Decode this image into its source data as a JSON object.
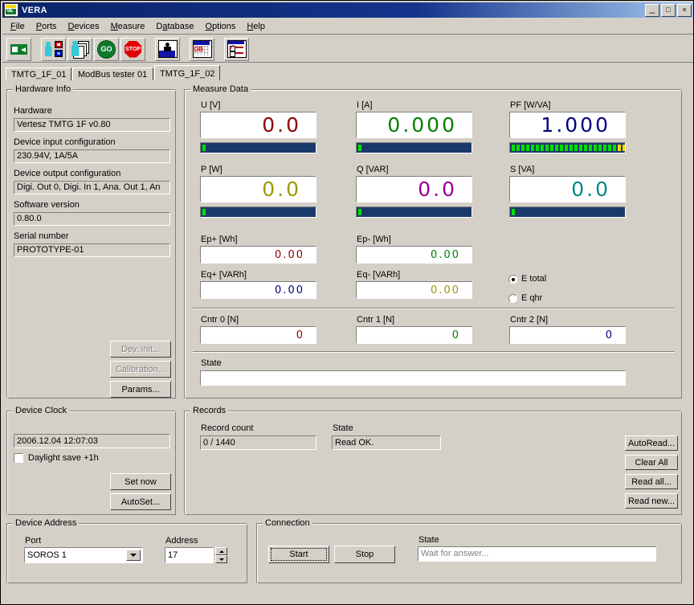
{
  "window": {
    "title": "VERA",
    "icon": "app-icon",
    "buttons": {
      "minimize": "_",
      "maximize": "□",
      "close": "×"
    }
  },
  "menu": [
    {
      "label": "File",
      "accel": "F"
    },
    {
      "label": "Ports",
      "accel": "P"
    },
    {
      "label": "Devices",
      "accel": "D"
    },
    {
      "label": "Measure",
      "accel": "M"
    },
    {
      "label": "Database",
      "accel": "a"
    },
    {
      "label": "Options",
      "accel": "O"
    },
    {
      "label": "Help",
      "accel": "H"
    }
  ],
  "toolbar": [
    {
      "icon": "connect-arrow-icon"
    },
    {
      "icon": "device-config-icon"
    },
    {
      "icon": "device-list-config-icon"
    },
    {
      "icon": "go-icon",
      "label": "GO"
    },
    {
      "icon": "stop-icon",
      "label": "STOP"
    },
    {
      "icon": "user-icon"
    },
    {
      "icon": "database-icon",
      "label": "DB"
    },
    {
      "icon": "checklist-icon"
    }
  ],
  "tabs": [
    {
      "label": "TMTG_1F_01",
      "active": false
    },
    {
      "label": "ModBus tester 01",
      "active": false
    },
    {
      "label": "TMTG_1F_02",
      "active": true
    }
  ],
  "hardware_info": {
    "title": "Hardware Info",
    "fields": [
      {
        "label": "Hardware",
        "value": "Vertesz TMTG 1F v0.80"
      },
      {
        "label": "Device input configuration",
        "value": "230.94V,  1A/5A"
      },
      {
        "label": "Device output configuration",
        "value": "Digi. Out 0,  Digi. In 1,  Ana. Out 1,  An"
      },
      {
        "label": "Software version",
        "value": "0.80.0"
      },
      {
        "label": "Serial number",
        "value": "PROTOTYPE-01"
      }
    ],
    "buttons": [
      {
        "label": "Dev. init...",
        "enabled": false
      },
      {
        "label": "Calibration...",
        "enabled": false
      },
      {
        "label": "Params...",
        "enabled": true
      }
    ]
  },
  "measure_data": {
    "title": "Measure Data",
    "gauges": [
      {
        "label": "U [V]",
        "value": "0.0",
        "color": "#8b0000",
        "segments": 1,
        "yellow": 0
      },
      {
        "label": "I [A]",
        "value": "0.000",
        "color": "#008000",
        "segments": 1,
        "yellow": 0
      },
      {
        "label": "PF [W/VA]",
        "value": "1.000",
        "color": "#000080",
        "segments": 25,
        "yellow": 3
      },
      {
        "label": "P [W]",
        "value": "0.0",
        "color": "#9b9b00",
        "segments": 1,
        "yellow": 0
      },
      {
        "label": "Q [VAR]",
        "value": "0.0",
        "color": "#990099",
        "segments": 1,
        "yellow": 0
      },
      {
        "label": "S [VA]",
        "value": "0.0",
        "color": "#008888",
        "segments": 1,
        "yellow": 0
      }
    ],
    "energy": [
      {
        "label": "Ep+ [Wh]",
        "value": "0.00",
        "color": "#8b0000"
      },
      {
        "label": "Ep- [Wh]",
        "value": "0.00",
        "color": "#008000"
      },
      {
        "label": "Eq+ [VARh]",
        "value": "0.00",
        "color": "#000080"
      },
      {
        "label": "Eq- [VARh]",
        "value": "0.00",
        "color": "#9b9b00"
      }
    ],
    "energy_mode": {
      "options": [
        {
          "label": "E total",
          "selected": true
        },
        {
          "label": "E qhr",
          "selected": false
        }
      ]
    },
    "counters": [
      {
        "label": "Cntr 0 [N]",
        "value": "0",
        "color": "#8b0000"
      },
      {
        "label": "Cntr 1 [N]",
        "value": "0",
        "color": "#008000"
      },
      {
        "label": "Cntr 2 [N]",
        "value": "0",
        "color": "#000080"
      }
    ],
    "state": {
      "label": "State",
      "value": ""
    }
  },
  "device_clock": {
    "title": "Device Clock",
    "datetime": "2006.12.04   12:07:03",
    "daylight": {
      "label": "Daylight save +1h",
      "checked": false
    },
    "buttons": [
      {
        "label": "Set now"
      },
      {
        "label": "AutoSet..."
      }
    ]
  },
  "records": {
    "title": "Records",
    "record_count": {
      "label": "Record count",
      "value": "0 / 1440"
    },
    "state": {
      "label": "State",
      "value": "Read OK."
    },
    "buttons": [
      {
        "label": "AutoRead..."
      },
      {
        "label": "Clear All"
      },
      {
        "label": "Read all..."
      },
      {
        "label": "Read new..."
      }
    ]
  },
  "device_address": {
    "title": "Device Address",
    "port": {
      "label": "Port",
      "value": "SOROS 1"
    },
    "address": {
      "label": "Address",
      "value": "17"
    }
  },
  "connection": {
    "title": "Connection",
    "start": {
      "label": "Start",
      "focused": true
    },
    "stop": {
      "label": "Stop"
    },
    "state": {
      "label": "State",
      "value": "Wait for answer..."
    }
  }
}
